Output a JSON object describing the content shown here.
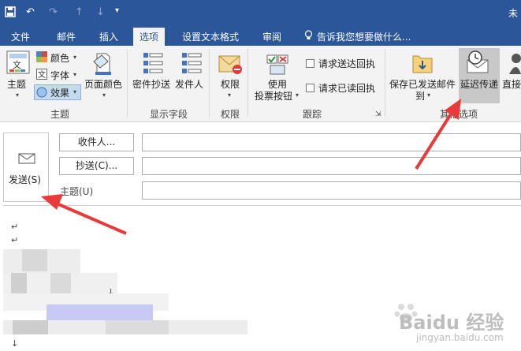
{
  "title_bar": {
    "title": "未"
  },
  "tabs": [
    "文件",
    "邮件",
    "插入",
    "选项",
    "设置文本格式",
    "审阅"
  ],
  "tell_me": "告诉我您想要做什么...",
  "ribbon": {
    "theme_group": {
      "theme": "主题",
      "colors": "颜色",
      "fonts": "字体",
      "effects": "效果",
      "page_color": "页面颜色",
      "label": "主题"
    },
    "fields_group": {
      "bcc": "密件抄送",
      "from": "发件人",
      "label": "显示字段"
    },
    "permission_group": {
      "permission": "权限",
      "label": "权限"
    },
    "tracking_group": {
      "voting_line1": "使用",
      "voting_line2": "投票按钮",
      "delivery_receipt": "请求送达回执",
      "read_receipt": "请求已读回执",
      "label": "跟踪"
    },
    "more_group": {
      "save_sent_line1": "保存已发送邮件",
      "save_sent_line2": "到",
      "delay": "延迟传递",
      "direct": "直接",
      "label": "其他选项"
    }
  },
  "compose": {
    "send": "发送(S)",
    "to": "收件人...",
    "cc": "抄送(C)...",
    "subject": "主题(U)"
  },
  "body": {
    "paragraph_mark": "↵",
    "fragment1": "↓",
    "fragment2": "↓"
  },
  "watermark": {
    "text": "Baidu 经验",
    "url": "jingyan.baidu.com"
  },
  "colors": {
    "brand": "#2b579a",
    "ribbon": "#f3f3f3",
    "arrow": "#e83a3a"
  }
}
